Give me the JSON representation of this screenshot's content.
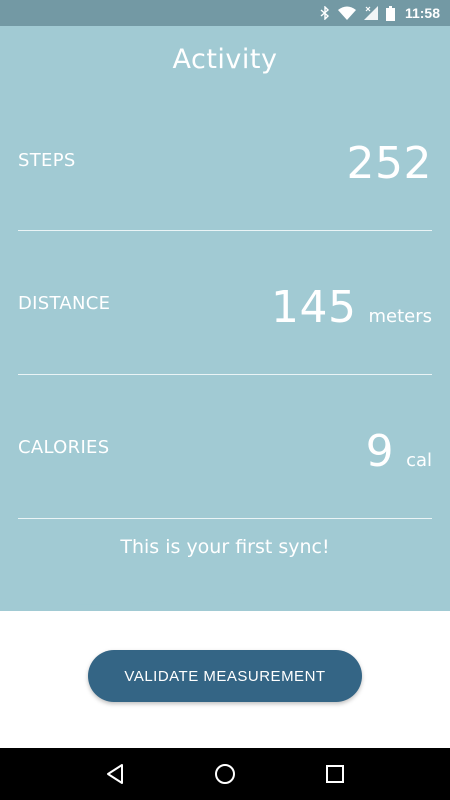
{
  "status_bar": {
    "time": "11:58",
    "icons": [
      "bluetooth-icon",
      "wifi-icon",
      "signal-icon",
      "battery-icon"
    ]
  },
  "header": {
    "title": "Activity"
  },
  "metrics": {
    "steps": {
      "label": "STEPS",
      "value": "252",
      "unit": ""
    },
    "distance": {
      "label": "DISTANCE",
      "value": "145",
      "unit": "meters"
    },
    "calories": {
      "label": "CALORIES",
      "value": "9",
      "unit": "cal"
    }
  },
  "sync_message": "This is your first sync!",
  "actions": {
    "validate_label": "VALIDATE MEASUREMENT"
  },
  "nav_bar": {
    "icons": [
      "back-icon",
      "home-icon",
      "recents-icon"
    ]
  },
  "colors": {
    "status_bar": "#7399a4",
    "panel": "#a1cad3",
    "button": "#346585",
    "nav_bar": "#000000"
  }
}
